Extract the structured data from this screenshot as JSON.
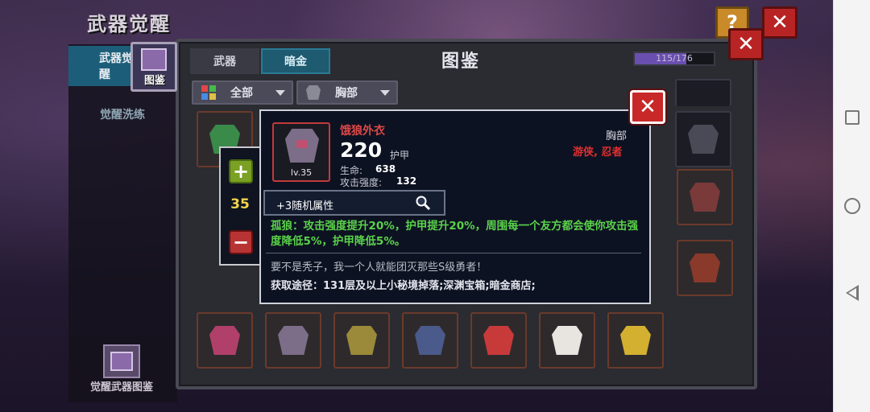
{
  "page": {
    "title": "武器觉醒",
    "help_label": "?",
    "close_label": "✕"
  },
  "sidebar": {
    "items": [
      {
        "label": "武器觉醒",
        "active": true
      },
      {
        "label": "觉醒洗练",
        "active": false
      }
    ],
    "atlas_label": "觉醒武器图鉴"
  },
  "atlas": {
    "badge_label": "图鉴",
    "title": "图鉴",
    "tabs": [
      {
        "label": "武器",
        "active": false
      },
      {
        "label": "暗金",
        "active": true
      }
    ],
    "progress": {
      "current": 115,
      "total": 176,
      "text": "115/176"
    },
    "filters": {
      "category": "全部",
      "slot": "胸部"
    },
    "close_label": "✕"
  },
  "stepper": {
    "plus_label": "+",
    "minus_label": "−",
    "value": "35"
  },
  "detail": {
    "name": "饿狼外衣",
    "level": "lv.35",
    "armor_value": "220",
    "armor_label": "护甲",
    "hp_label": "生命:",
    "hp_value": "638",
    "atk_label": "攻击强度:",
    "atk_value": "132",
    "slot": "胸部",
    "classes": "游侠, 忍者",
    "random_attr": "+3随机属性",
    "effect": "孤狼：攻击强度提升20%，护甲提升20%，周围每一个友方都会使你攻击强度降低5%，护甲降低5%。",
    "quote": "要不是秃子，我一个人就能团灭那些S级勇者！",
    "source": "获取途径：131层及以上小秘境掉落;深渊宝箱;暗金商店;",
    "close_label": "✕"
  },
  "colors": {
    "accent_teal": "#1e5a70",
    "danger_red": "#c82828",
    "effect_green": "#5ad24a",
    "class_red": "#e03030",
    "value_yellow": "#f2d44a"
  },
  "icons": {
    "grid_items": [
      "armor-item-icon",
      "armor-item-icon",
      "armor-item-icon",
      "armor-item-icon",
      "armor-item-icon",
      "armor-item-icon",
      "armor-item-icon"
    ]
  }
}
